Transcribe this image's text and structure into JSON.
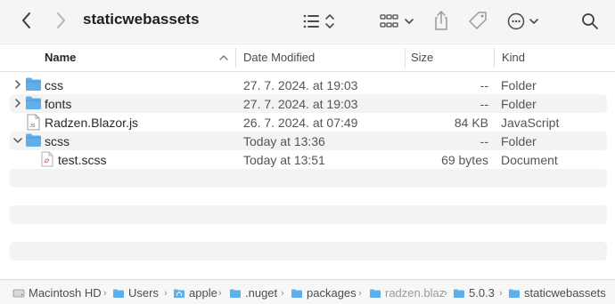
{
  "window": {
    "title": "staticwebassets"
  },
  "columns": {
    "name": "Name",
    "date": "Date Modified",
    "size": "Size",
    "kind": "Kind"
  },
  "rows": [
    {
      "name": "css",
      "date": "27. 7. 2024. at 19:03",
      "size": "--",
      "kind": "Folder",
      "icon": "folder-icon",
      "disclosure": "collapsed"
    },
    {
      "name": "fonts",
      "date": "27. 7. 2024. at 19:03",
      "size": "--",
      "kind": "Folder",
      "icon": "folder-icon",
      "disclosure": "collapsed"
    },
    {
      "name": "Radzen.Blazor.js",
      "date": "26. 7. 2024. at 07:49",
      "size": "84 KB",
      "kind": "JavaScript",
      "icon": "js-file-icon",
      "disclosure": "none"
    },
    {
      "name": "scss",
      "date": "Today at 13:36",
      "size": "--",
      "kind": "Folder",
      "icon": "folder-icon",
      "disclosure": "expanded"
    },
    {
      "name": "test.scss",
      "date": "Today at 13:51",
      "size": "69 bytes",
      "kind": "Document",
      "icon": "scss-file-icon",
      "disclosure": "none"
    }
  ],
  "pathbar": [
    {
      "label": "Macintosh HD",
      "icon": "drive-icon"
    },
    {
      "label": "Users",
      "icon": "folder-icon"
    },
    {
      "label": "apple",
      "icon": "home-folder-icon"
    },
    {
      "label": ".nuget",
      "icon": "folder-icon"
    },
    {
      "label": "packages",
      "icon": "folder-icon"
    },
    {
      "label": "radzen.blaz",
      "icon": "folder-icon"
    },
    {
      "label": "5.0.3",
      "icon": "folder-icon"
    },
    {
      "label": "staticwebassets",
      "icon": "folder-icon"
    }
  ],
  "colors": {
    "folder": "#5fb0ea",
    "toolbar_bg": "#f5f5f5",
    "row_alt": "#f3f3f3"
  }
}
